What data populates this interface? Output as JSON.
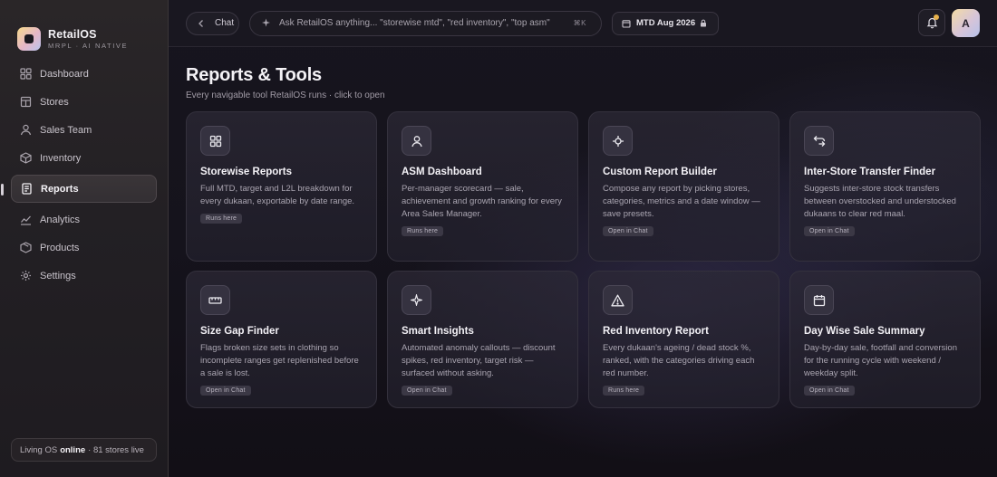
{
  "app": {
    "name": "RetailOS",
    "tagline": "MRPL · AI NATIVE"
  },
  "sidebar": {
    "items": [
      {
        "label": "Dashboard",
        "icon": "grid-icon"
      },
      {
        "label": "Stores",
        "icon": "store-icon"
      },
      {
        "label": "Sales Team",
        "icon": "user-icon"
      },
      {
        "label": "Inventory",
        "icon": "box-icon"
      },
      {
        "label": "Reports",
        "icon": "document-icon",
        "active": true
      },
      {
        "label": "Analytics",
        "icon": "chart-icon"
      },
      {
        "label": "Products",
        "icon": "package-icon"
      },
      {
        "label": "Settings",
        "icon": "gear-icon"
      }
    ],
    "status": {
      "prefix": "Living OS",
      "state": "online",
      "suffix": "· 81 stores live"
    }
  },
  "topbar": {
    "back_label": "Chat",
    "search_placeholder": "Ask RetailOS anything... \"storewise mtd\", \"red inventory\", \"top asm\"",
    "search_shortcut": "⌘K",
    "period_label": "MTD Aug 2026",
    "avatar_initial": "A"
  },
  "page": {
    "title": "Reports & Tools",
    "subtitle": "Every navigable tool RetailOS runs · click to open"
  },
  "cards": [
    {
      "title": "Storewise Reports",
      "desc": "Full MTD, target and L2L breakdown for every dukaan, exportable by date range.",
      "badge": "Runs here",
      "icon": "grid-icon"
    },
    {
      "title": "ASM Dashboard",
      "desc": "Per-manager scorecard — sale, achievement and growth ranking for every Area Sales Manager.",
      "badge": "Runs here",
      "icon": "user-icon"
    },
    {
      "title": "Custom Report Builder",
      "desc": "Compose any report by picking stores, categories, metrics and a date window — save presets.",
      "badge": "Open in Chat",
      "icon": "crosshair-icon"
    },
    {
      "title": "Inter-Store Transfer Finder",
      "desc": "Suggests inter-store stock transfers between overstocked and understocked dukaans to clear red maal.",
      "badge": "Open in Chat",
      "icon": "transfer-icon"
    },
    {
      "title": "Size Gap Finder",
      "desc": "Flags broken size sets in clothing so incomplete ranges get replenished before a sale is lost.",
      "badge": "Open in Chat",
      "icon": "ruler-icon"
    },
    {
      "title": "Smart Insights",
      "desc": "Automated anomaly callouts — discount spikes, red inventory, target risk — surfaced without asking.",
      "badge": "Open in Chat",
      "icon": "sparkle-icon"
    },
    {
      "title": "Red Inventory Report",
      "desc": "Every dukaan's ageing / dead stock %, ranked, with the categories driving each red number.",
      "badge": "Runs here",
      "icon": "warning-icon"
    },
    {
      "title": "Day Wise Sale Summary",
      "desc": "Day-by-day sale, footfall and conversion for the running cycle with weekend / weekday split.",
      "badge": "Open in Chat",
      "icon": "calendar-icon"
    }
  ]
}
